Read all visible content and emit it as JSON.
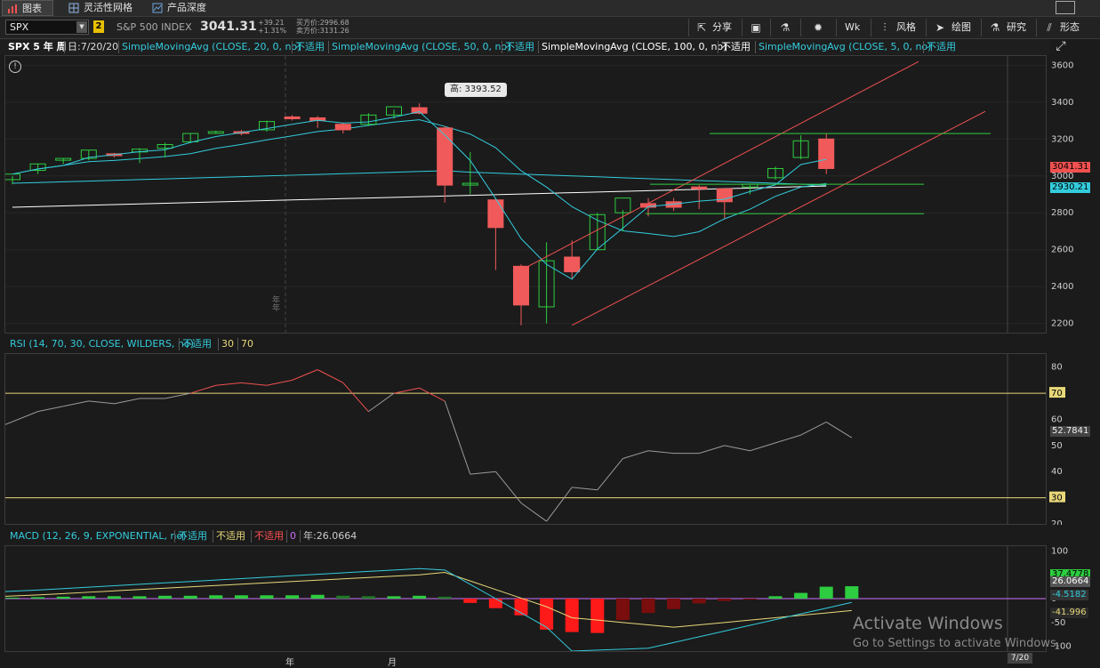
{
  "tabs": [
    {
      "label": "图表",
      "icon": "bar-chart-icon"
    },
    {
      "label": "灵活性网格",
      "icon": "grid-icon"
    },
    {
      "label": "产品深度",
      "icon": "depth-icon"
    }
  ],
  "symbol": {
    "value": "SPX",
    "link_badge": "2",
    "name": "S&P 500 INDEX",
    "last": "3041.31",
    "change": "+39.21",
    "change_pct": "+1.31%",
    "bid": "买方价:2996.68",
    "ask": "卖方价:3131.26"
  },
  "toolbar": {
    "share": "分享",
    "wk": "Wk",
    "style": "风格",
    "draw": "绘图",
    "study": "研究",
    "pattern": "形态"
  },
  "studies": {
    "header": "SPX 5 年 周",
    "date": "日:7/20/20",
    "na": "不适用",
    "sma20": "SimpleMovingAvg (CLOSE, 20, 0, no)",
    "sma50": "SimpleMovingAvg (CLOSE, 50, 0, no)",
    "sma100": "SimpleMovingAvg (CLOSE, 100, 0, no)",
    "sma5": "SimpleMovingAvg (CLOSE, 5, 0, no)",
    "sma20_color": "#33ccdd",
    "sma50_color": "#33ccdd",
    "sma100_color": "#ffffff",
    "sma5_color": "#33ccdd"
  },
  "rsi": {
    "label": "RSI (14, 70, 30, CLOSE, WILDERS, no)",
    "na": "不适用",
    "ob": "30",
    "os": "70",
    "value": "52.7841"
  },
  "macd": {
    "label": "MACD (12, 26, 9, EXPONENTIAL, no)",
    "na1": "不适用",
    "na2": "不适用",
    "na3": "不适用",
    "zero": "0",
    "year": "年:26.0664",
    "v1": "37.4778",
    "v2": "26.0664",
    "v3": "-4.5182",
    "v4": "-41.996"
  },
  "price_badges": {
    "last": "3041.31",
    "sma": "2930.21"
  },
  "high_label": "高: 3393.52",
  "x_labels": {
    "year": "年",
    "month": "月",
    "date": "7/20"
  },
  "vertical_year_label": "年\n年",
  "watermark": {
    "line1": "Activate Windows",
    "line2": "Go to Settings to activate Windows."
  },
  "chart_data": [
    {
      "type": "candlestick",
      "title": "SPX 5 年 周",
      "ylim": [
        2150,
        3650
      ],
      "yticks": [
        2200,
        2400,
        2600,
        2800,
        3000,
        3200,
        3400,
        3600
      ],
      "candles": [
        {
          "o": 2980,
          "h": 3000,
          "l": 2955,
          "c": 3010
        },
        {
          "o": 3030,
          "h": 3065,
          "l": 3010,
          "c": 3065
        },
        {
          "o": 3085,
          "h": 3095,
          "l": 3065,
          "c": 3095
        },
        {
          "o": 3095,
          "h": 3140,
          "l": 3085,
          "c": 3140
        },
        {
          "o": 3120,
          "h": 3125,
          "l": 3100,
          "c": 3110
        },
        {
          "o": 3130,
          "h": 3150,
          "l": 3070,
          "c": 3145
        },
        {
          "o": 3150,
          "h": 3180,
          "l": 3100,
          "c": 3170
        },
        {
          "o": 3185,
          "h": 3230,
          "l": 3180,
          "c": 3230
        },
        {
          "o": 3235,
          "h": 3245,
          "l": 3230,
          "c": 3240
        },
        {
          "o": 3240,
          "h": 3250,
          "l": 3220,
          "c": 3235
        },
        {
          "o": 3250,
          "h": 3300,
          "l": 3240,
          "c": 3295
        },
        {
          "o": 3320,
          "h": 3330,
          "l": 3300,
          "c": 3310
        },
        {
          "o": 3315,
          "h": 3325,
          "l": 3260,
          "c": 3300
        },
        {
          "o": 3280,
          "h": 3290,
          "l": 3230,
          "c": 3250
        },
        {
          "o": 3280,
          "h": 3340,
          "l": 3270,
          "c": 3330
        },
        {
          "o": 3330,
          "h": 3360,
          "l": 3310,
          "c": 3375
        },
        {
          "o": 3370,
          "h": 3393.52,
          "l": 3335,
          "c": 3340
        },
        {
          "o": 3260,
          "h": 3270,
          "l": 2855,
          "c": 2950
        },
        {
          "o": 2960,
          "h": 3130,
          "l": 2900,
          "c": 2960
        },
        {
          "o": 2870,
          "h": 2880,
          "l": 2490,
          "c": 2720
        },
        {
          "o": 2510,
          "h": 2520,
          "l": 2190,
          "c": 2300
        },
        {
          "o": 2290,
          "h": 2640,
          "l": 2200,
          "c": 2540
        },
        {
          "o": 2560,
          "h": 2650,
          "l": 2445,
          "c": 2480
        },
        {
          "o": 2600,
          "h": 2800,
          "l": 2600,
          "c": 2790
        },
        {
          "o": 2800,
          "h": 2815,
          "l": 2700,
          "c": 2880
        },
        {
          "o": 2850,
          "h": 2880,
          "l": 2780,
          "c": 2830
        },
        {
          "o": 2860,
          "h": 2880,
          "l": 2810,
          "c": 2830
        },
        {
          "o": 2940,
          "h": 2950,
          "l": 2820,
          "c": 2930
        },
        {
          "o": 2930,
          "h": 2935,
          "l": 2770,
          "c": 2860
        },
        {
          "o": 2940,
          "h": 2950,
          "l": 2900,
          "c": 2955
        },
        {
          "o": 2990,
          "h": 3050,
          "l": 2980,
          "c": 3040
        },
        {
          "o": 3100,
          "h": 3220,
          "l": 3090,
          "c": 3190
        },
        {
          "o": 3200,
          "h": 3230,
          "l": 3010,
          "c": 3040
        }
      ]
    },
    {
      "type": "line",
      "title": "RSI (14, 70, 30, CLOSE, WILDERS, no)",
      "ylim": [
        20,
        85
      ],
      "yticks": [
        20,
        30,
        40,
        50,
        60,
        70,
        80
      ],
      "values": [
        58,
        63,
        65,
        67,
        66,
        68,
        68,
        70,
        73,
        74,
        73,
        75,
        79,
        74,
        63,
        70,
        72,
        67,
        39,
        40,
        28,
        21,
        34,
        33,
        45,
        48,
        47,
        47,
        50,
        48,
        51,
        54,
        59,
        53
      ]
    },
    {
      "type": "bar",
      "title": "MACD (12, 26, 9, EXPONENTIAL, no)",
      "ylim": [
        -110,
        110
      ],
      "yticks": [
        100,
        50,
        0,
        -50,
        -100
      ],
      "hist": [
        2,
        3,
        4,
        5,
        5,
        5,
        6,
        6,
        7,
        7,
        7,
        7,
        8,
        6,
        5,
        5,
        6,
        4,
        -9,
        -20,
        -35,
        -65,
        -70,
        -72,
        -45,
        -30,
        -22,
        -10,
        -5,
        -2,
        5,
        12,
        25,
        26
      ]
    }
  ]
}
